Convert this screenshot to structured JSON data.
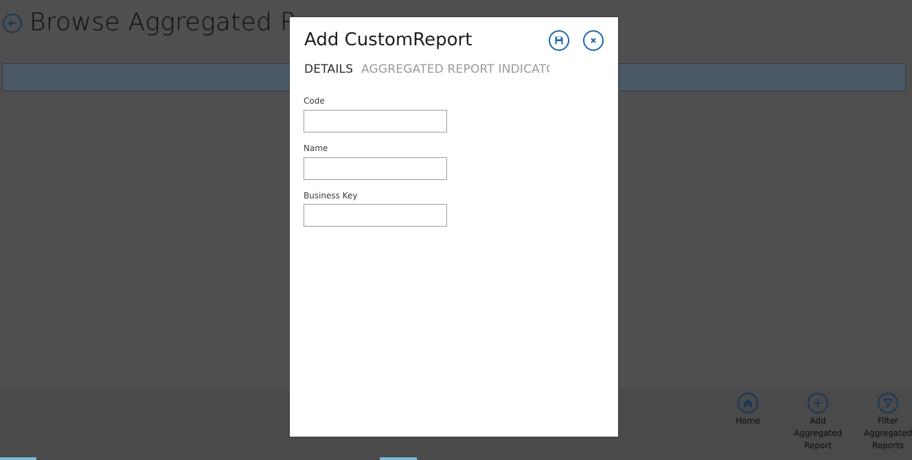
{
  "background_page": {
    "title": "Browse Aggregated Rep",
    "back_icon": "arrow-left-icon"
  },
  "app_bar": {
    "buttons": [
      {
        "label": "Home",
        "icon": "home-icon"
      },
      {
        "label": "Add\nAggregated\nReport",
        "icon": "plus-icon"
      },
      {
        "label": "Filter\nAggregated\nReports",
        "icon": "filter-icon"
      }
    ]
  },
  "modal": {
    "title": "Add CustomReport",
    "save_icon": "save-icon",
    "close_icon": "close-icon",
    "tabs": [
      {
        "label": "DETAILS",
        "active": true
      },
      {
        "label": "AGGREGATED REPORT INDICATO",
        "active": false
      }
    ],
    "fields": [
      {
        "label": "Code",
        "value": "",
        "placeholder": ""
      },
      {
        "label": "Name",
        "value": "",
        "placeholder": ""
      },
      {
        "label": "Business Key",
        "value": "",
        "placeholder": ""
      }
    ]
  },
  "colors": {
    "accent": "#1a66a8",
    "overlay_bg": "#4f4f4f",
    "header_bar": "#4b5866",
    "bottom_strip": "#7ab8d8"
  }
}
